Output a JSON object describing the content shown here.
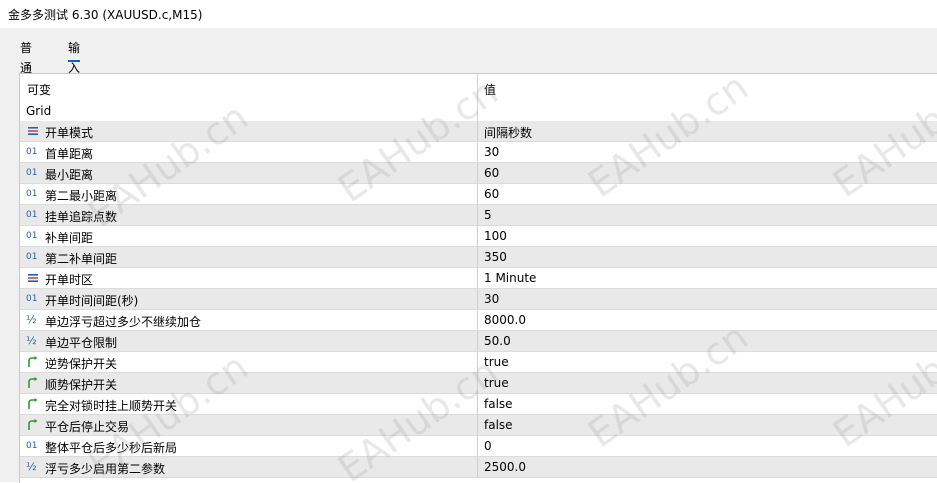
{
  "window": {
    "title": "金多多测试 6.30 (XAUUSD.c,M15)"
  },
  "tabs": [
    {
      "label": "普通",
      "active": false
    },
    {
      "label": "输入",
      "active": true
    }
  ],
  "table": {
    "headers": {
      "variable": "可变",
      "value": "值"
    },
    "group": "Grid",
    "rows": [
      {
        "icon": "enum-icon",
        "name": "开单模式",
        "value": "间隔秒数"
      },
      {
        "icon": "int-icon",
        "name": "首单距离",
        "value": "30"
      },
      {
        "icon": "int-icon",
        "name": "最小距离",
        "value": "60"
      },
      {
        "icon": "int-icon",
        "name": "第二最小距离",
        "value": "60"
      },
      {
        "icon": "int-icon",
        "name": "挂单追踪点数",
        "value": "5"
      },
      {
        "icon": "int-icon",
        "name": "补单间距",
        "value": "100"
      },
      {
        "icon": "int-icon",
        "name": "第二补单间距",
        "value": "350"
      },
      {
        "icon": "enum-icon",
        "name": "开单时区",
        "value": "1 Minute"
      },
      {
        "icon": "int-icon",
        "name": "开单时间间距(秒)",
        "value": "30"
      },
      {
        "icon": "double-icon",
        "name": "单边浮亏超过多少不继续加仓",
        "value": "8000.0"
      },
      {
        "icon": "double-icon",
        "name": "单边平仓限制",
        "value": "50.0"
      },
      {
        "icon": "bool-icon",
        "name": "逆势保护开关",
        "value": "true"
      },
      {
        "icon": "bool-icon",
        "name": "顺势保护开关",
        "value": "true"
      },
      {
        "icon": "bool-icon",
        "name": "完全对锁时挂上顺势开关",
        "value": "false"
      },
      {
        "icon": "bool-icon",
        "name": "平仓后停止交易",
        "value": "false"
      },
      {
        "icon": "int-icon",
        "name": "整体平仓后多少秒后新局",
        "value": "0"
      },
      {
        "icon": "double-icon",
        "name": "浮亏多少启用第二参数",
        "value": "2500.0"
      }
    ]
  },
  "icon_glyphs": {
    "int-icon": "01",
    "double-icon": "½"
  },
  "colors": {
    "accent": "#0a64c8",
    "row_alt": "#e9e9e9",
    "bool_icon": "#2e9a2e",
    "enum_icon_top": "#1f5fbf",
    "enum_icon_bottom": "#d24b3a"
  },
  "watermark": "EAHub.cn"
}
